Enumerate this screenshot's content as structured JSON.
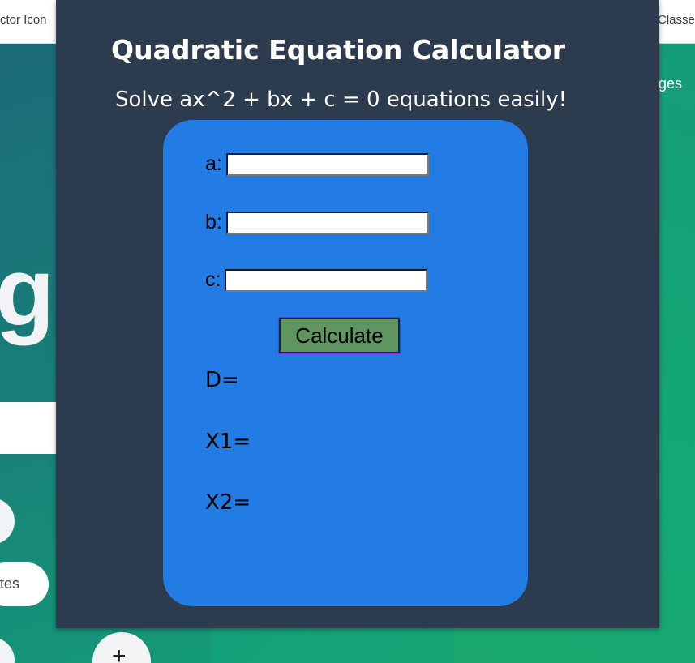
{
  "browser": {
    "bookmark_left": "ctor Icon",
    "bookmark_right": "Classe"
  },
  "background": {
    "logo_fragment": "gle",
    "right_text": "ges",
    "shortcut_label": "tes",
    "add_glyph": "+"
  },
  "popup": {
    "title": "Quadratic Equation Calculator",
    "subtitle": "Solve ax^2 + bx + c = 0 equations easily!",
    "fields": {
      "a": {
        "label": "a:",
        "value": ""
      },
      "b": {
        "label": "b:",
        "value": ""
      },
      "c": {
        "label": "c:",
        "value": ""
      }
    },
    "calculate_label": "Calculate",
    "results": {
      "d_label": "D=",
      "x1_label": "X1=",
      "x2_label": "X2="
    }
  },
  "colors": {
    "popup_bg": "#2d3b4f",
    "card_bg": "#237ce3",
    "button_bg": "#5f9660",
    "page_bg_accent": "#13a07a"
  }
}
